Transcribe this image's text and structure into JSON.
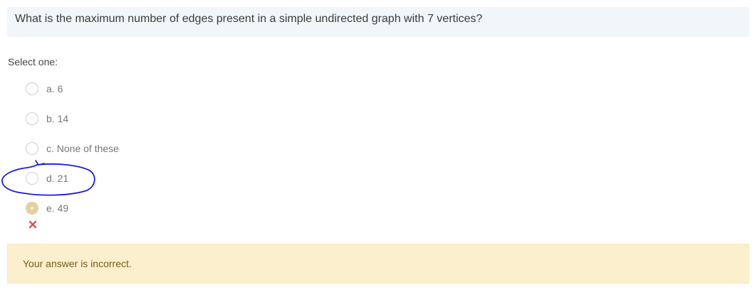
{
  "question": {
    "text": "What is the maximum number of edges present in a simple undirected graph with 7 vertices?"
  },
  "prompt": "Select one:",
  "options": [
    {
      "label": "a. 6",
      "selected": false
    },
    {
      "label": "b. 14",
      "selected": false
    },
    {
      "label": "c. None of these",
      "selected": false
    },
    {
      "label": "d. 21",
      "selected": false
    },
    {
      "label": "e. 49",
      "selected": true
    }
  ],
  "result_icon": "cross-icon",
  "feedback": {
    "text": "Your answer is incorrect."
  },
  "colors": {
    "question_bg": "#f2f6fa",
    "selected_radio": "#e2d19f",
    "wrong_mark": "#d9534f",
    "feedback_bg": "#fcefcd",
    "annotation_ink": "#1a1adf"
  }
}
